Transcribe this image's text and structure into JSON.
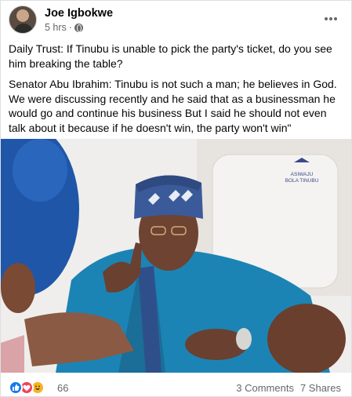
{
  "post": {
    "author": "Joe Igbokwe",
    "time": "5 hrs",
    "privacy_icon": "globe-icon",
    "paragraphs": [
      "Daily Trust: If Tinubu is unable to pick the party's ticket, do you see him breaking the table?",
      "Senator Abu Ibrahim: Tinubu is not such a man; he believes in God. We were discussing recently and he said that as a businessman he would go and continue his business But I said he should not even talk about it because if he doesn't win, the party won't win\""
    ],
    "photo_caption_text": "ASIWAJU BOLA TINUBU"
  },
  "footer": {
    "reaction_icons": [
      "like-icon",
      "love-icon",
      "haha-icon"
    ],
    "reaction_count": "66",
    "comments": "3 Comments",
    "shares": "7 Shares"
  },
  "colors": {
    "facebook_blue": "#1877f2",
    "secondary_text": "#65676b",
    "love_red": "#f33e58",
    "haha_yellow": "#f7b125"
  }
}
